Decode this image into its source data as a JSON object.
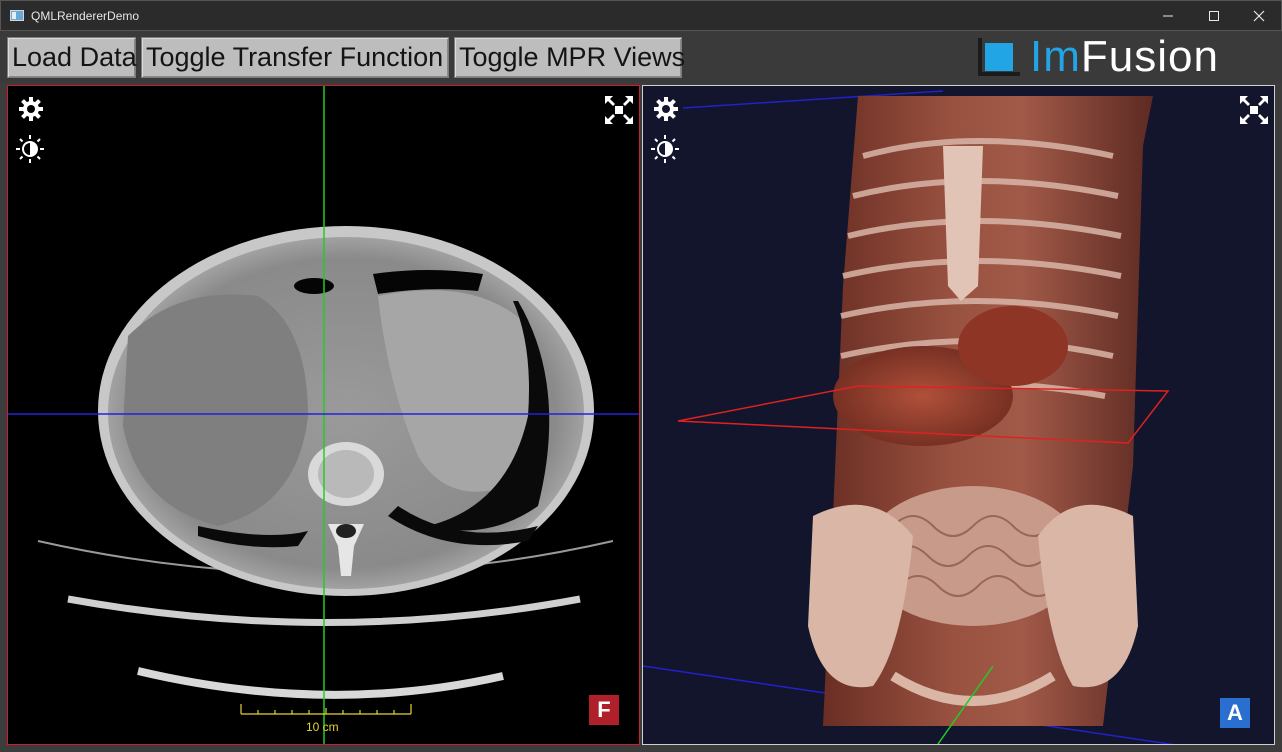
{
  "window": {
    "title": "QMLRendererDemo",
    "controls": {
      "minimize": "—",
      "maximize": "☐",
      "close": "✕"
    }
  },
  "toolbar": {
    "buttons": [
      {
        "label": "Load Data"
      },
      {
        "label": "Toggle Transfer Function"
      },
      {
        "label": "Toggle MPR Views"
      }
    ]
  },
  "logo": {
    "part1": "Im",
    "part2": "Fusion"
  },
  "left_view": {
    "orientation_badge": "F",
    "scale_label": "10 cm",
    "icons": [
      "gear-icon",
      "contrast-icon",
      "maximize-icon"
    ],
    "colors": {
      "border": "#c8202a",
      "vertical_crosshair": "#22cc22",
      "horizontal_crosshair": "#2222dd",
      "badge": "#b0202a",
      "scale": "#e4d335"
    }
  },
  "right_view": {
    "orientation_badge": "A",
    "icons": [
      "gear-icon",
      "contrast-icon",
      "maximize-icon"
    ],
    "colors": {
      "background": "#12152b",
      "slice_plane": "#dd2222",
      "badge": "#2a6fd0"
    }
  }
}
